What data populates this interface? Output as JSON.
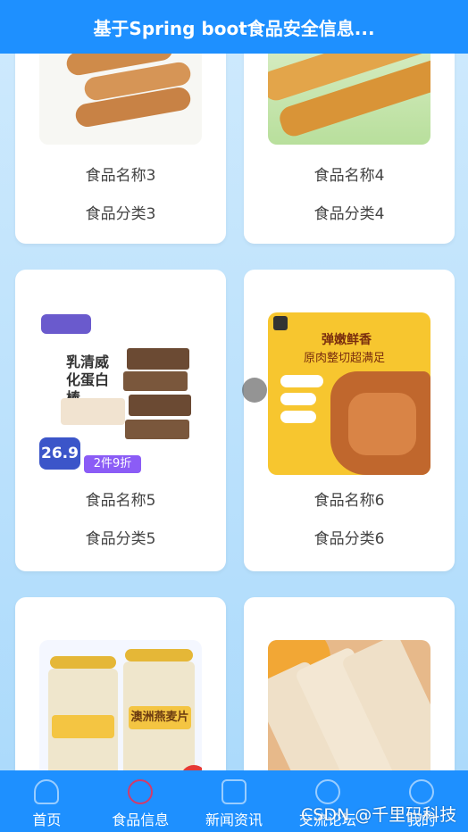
{
  "header": {
    "title": "基于Spring boot食品安全信息..."
  },
  "foods": [
    {
      "name": "食品名称3",
      "category": "食品分类3",
      "image_icon": "sausage-pack-image"
    },
    {
      "name": "食品名称4",
      "category": "食品分类4",
      "image_icon": "sausage-sticks-image"
    },
    {
      "name": "食品名称5",
      "category": "食品分类5",
      "image_icon": "protein-bar-image",
      "image_text": {
        "title": "乳清威化蛋白棒",
        "price": "26.9",
        "promo": "2件9折"
      }
    },
    {
      "name": "食品名称6",
      "category": "食品分类6",
      "image_icon": "jerky-image",
      "image_text": {
        "title": "弹嫩鲜香",
        "subtitle": "原肉整切超满足"
      }
    },
    {
      "name": "",
      "category": "",
      "image_icon": "oatmeal-jar-image",
      "image_text": {
        "label": "澳洲燕麦片"
      }
    },
    {
      "name": "",
      "category": "",
      "image_icon": "bread-image"
    }
  ],
  "tabbar": {
    "items": [
      {
        "label": "首页",
        "icon": "home-icon",
        "active": false
      },
      {
        "label": "食品信息",
        "icon": "food-info-icon",
        "active": true
      },
      {
        "label": "新闻资讯",
        "icon": "news-icon",
        "active": false
      },
      {
        "label": "交流论坛",
        "icon": "forum-icon",
        "active": false
      },
      {
        "label": "我的",
        "icon": "user-icon",
        "active": false
      }
    ]
  },
  "watermark": "CSDN @千里码科技",
  "colors": {
    "primary": "#1e90ff",
    "active_icon": "#d23b6b",
    "background": "#cfeafd"
  }
}
